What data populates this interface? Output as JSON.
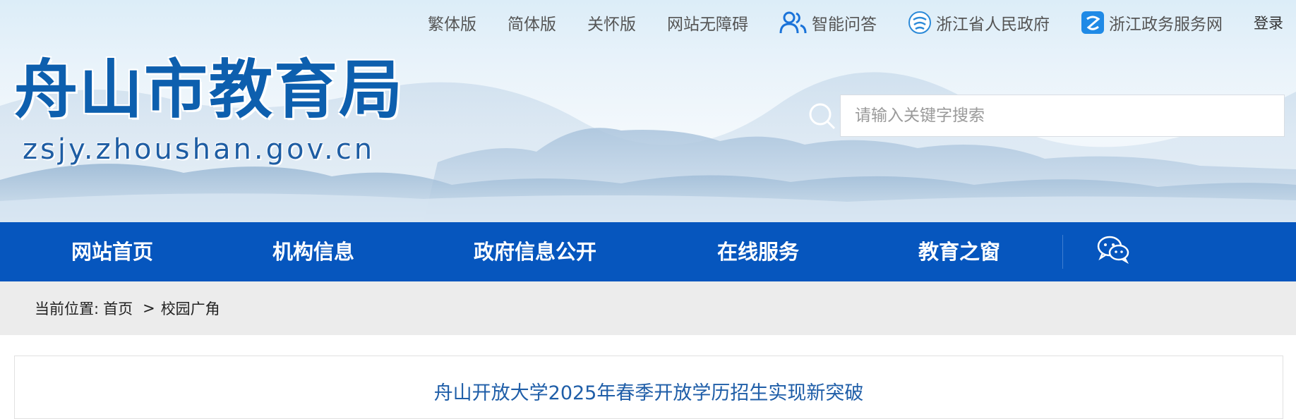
{
  "topbar": {
    "traditional": "繁体版",
    "simplified": "简体版",
    "care": "关怀版",
    "accessibility": "网站无障碍",
    "smart_qa": "智能问答",
    "zj_gov": "浙江省人民政府",
    "zj_service": "浙江政务服务网",
    "login": "登录"
  },
  "header": {
    "title": "舟山市教育局",
    "domain": "zsjy.zhoushan.gov.cn"
  },
  "search": {
    "placeholder": "请输入关键字搜索",
    "icon": "search-icon"
  },
  "nav": {
    "items": [
      "网站首页",
      "机构信息",
      "政府信息公开",
      "在线服务",
      "教育之窗"
    ],
    "wechat_icon": "wechat-icon"
  },
  "breadcrumb": {
    "label": "当前位置:",
    "home": "首页",
    "separator": ">",
    "current": "校园广角"
  },
  "article": {
    "title": "舟山开放大学2025年春季开放学历招生实现新突破"
  },
  "colors": {
    "nav_bg": "#0656be",
    "title_blue": "#0d5fae",
    "article_title": "#1f5ea8",
    "breadcrumb_bg": "#ececec"
  }
}
